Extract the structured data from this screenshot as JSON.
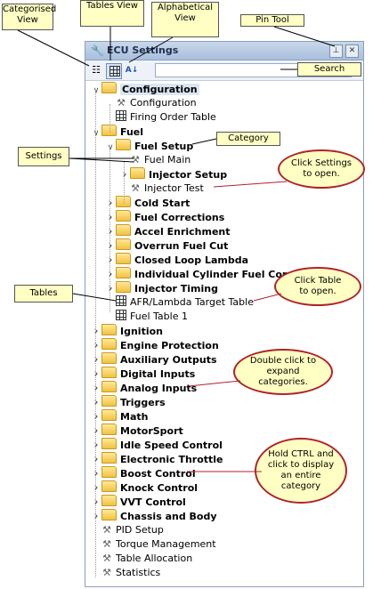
{
  "panel": {
    "title": "ECU Settings",
    "icons": {
      "title": "wrench-icon",
      "pin": "pin-icon",
      "close": "close-icon"
    },
    "search_placeholder": ""
  },
  "tree": [
    {
      "label": "Configuration",
      "bold": true,
      "exp": "open",
      "icon": "folder",
      "level": 0,
      "sel": true
    },
    {
      "label": "Configuration",
      "bold": false,
      "exp": "",
      "icon": "wrench",
      "level": 1
    },
    {
      "label": "Firing Order Table",
      "bold": false,
      "exp": "",
      "icon": "table",
      "level": 1
    },
    {
      "label": "Fuel",
      "bold": true,
      "exp": "open",
      "icon": "folder",
      "level": 0
    },
    {
      "label": "Fuel Setup",
      "bold": true,
      "exp": "open",
      "icon": "folder",
      "level": 1
    },
    {
      "label": "Fuel Main",
      "bold": false,
      "exp": "",
      "icon": "wrench",
      "level": 2
    },
    {
      "label": "Injector Setup",
      "bold": true,
      "exp": "closed",
      "icon": "folder",
      "level": 2
    },
    {
      "label": "Injector Test",
      "bold": false,
      "exp": "",
      "icon": "wrench",
      "level": 2
    },
    {
      "label": "Cold Start",
      "bold": true,
      "exp": "closed",
      "icon": "folder",
      "level": 1
    },
    {
      "label": "Fuel Corrections",
      "bold": true,
      "exp": "closed",
      "icon": "folder",
      "level": 1
    },
    {
      "label": "Accel Enrichment",
      "bold": true,
      "exp": "closed",
      "icon": "folder",
      "level": 1
    },
    {
      "label": "Overrun Fuel Cut",
      "bold": true,
      "exp": "closed",
      "icon": "folder",
      "level": 1
    },
    {
      "label": "Closed Loop Lambda",
      "bold": true,
      "exp": "closed",
      "icon": "folder",
      "level": 1
    },
    {
      "label": "Individual Cylinder Fuel Corr.",
      "bold": true,
      "exp": "closed",
      "icon": "folder",
      "level": 1
    },
    {
      "label": "Injector Timing",
      "bold": true,
      "exp": "closed",
      "icon": "folder",
      "level": 1
    },
    {
      "label": "AFR/Lambda Target Table",
      "bold": false,
      "exp": "",
      "icon": "table",
      "level": 1
    },
    {
      "label": "Fuel Table 1",
      "bold": false,
      "exp": "",
      "icon": "table",
      "level": 1
    },
    {
      "label": "Ignition",
      "bold": true,
      "exp": "closed",
      "icon": "folder",
      "level": 0
    },
    {
      "label": "Engine Protection",
      "bold": true,
      "exp": "closed",
      "icon": "folder",
      "level": 0
    },
    {
      "label": "Auxiliary Outputs",
      "bold": true,
      "exp": "closed",
      "icon": "folder",
      "level": 0
    },
    {
      "label": "Digital Inputs",
      "bold": true,
      "exp": "closed",
      "icon": "folder",
      "level": 0
    },
    {
      "label": "Analog Inputs",
      "bold": true,
      "exp": "closed",
      "icon": "folder",
      "level": 0
    },
    {
      "label": "Triggers",
      "bold": true,
      "exp": "closed",
      "icon": "folder",
      "level": 0
    },
    {
      "label": "Math",
      "bold": true,
      "exp": "closed",
      "icon": "folder",
      "level": 0
    },
    {
      "label": "MotorSport",
      "bold": true,
      "exp": "closed",
      "icon": "folder",
      "level": 0
    },
    {
      "label": "Idle Speed Control",
      "bold": true,
      "exp": "closed",
      "icon": "folder",
      "level": 0
    },
    {
      "label": "Electronic Throttle",
      "bold": true,
      "exp": "closed",
      "icon": "folder",
      "level": 0
    },
    {
      "label": "Boost Control",
      "bold": true,
      "exp": "closed",
      "icon": "folder",
      "level": 0
    },
    {
      "label": "Knock Control",
      "bold": true,
      "exp": "closed",
      "icon": "folder",
      "level": 0
    },
    {
      "label": "VVT Control",
      "bold": true,
      "exp": "closed",
      "icon": "folder",
      "level": 0
    },
    {
      "label": "Chassis and Body",
      "bold": true,
      "exp": "closed",
      "icon": "folder",
      "level": 0
    },
    {
      "label": "PID Setup",
      "bold": false,
      "exp": "",
      "icon": "wrench",
      "level": 0
    },
    {
      "label": "Torque Management",
      "bold": false,
      "exp": "",
      "icon": "wrench",
      "level": 0
    },
    {
      "label": "Table Allocation",
      "bold": false,
      "exp": "",
      "icon": "wrench",
      "level": 0
    },
    {
      "label": "Statistics",
      "bold": false,
      "exp": "",
      "icon": "wrench",
      "level": 0
    }
  ],
  "callouts": {
    "categorised_view": "Categorised View",
    "tables_view": "Tables View",
    "alphabetical_view": "Alphabetical View",
    "pin_tool": "Pin Tool",
    "search": "Search",
    "category": "Category",
    "settings": "Settings",
    "tables": "Tables",
    "click_settings": "Click Settings to open.",
    "click_table": "Click Table to open.",
    "double_click": "Double click to expand categories.",
    "hold_ctrl": "Hold CTRL and click to display an entire category"
  }
}
